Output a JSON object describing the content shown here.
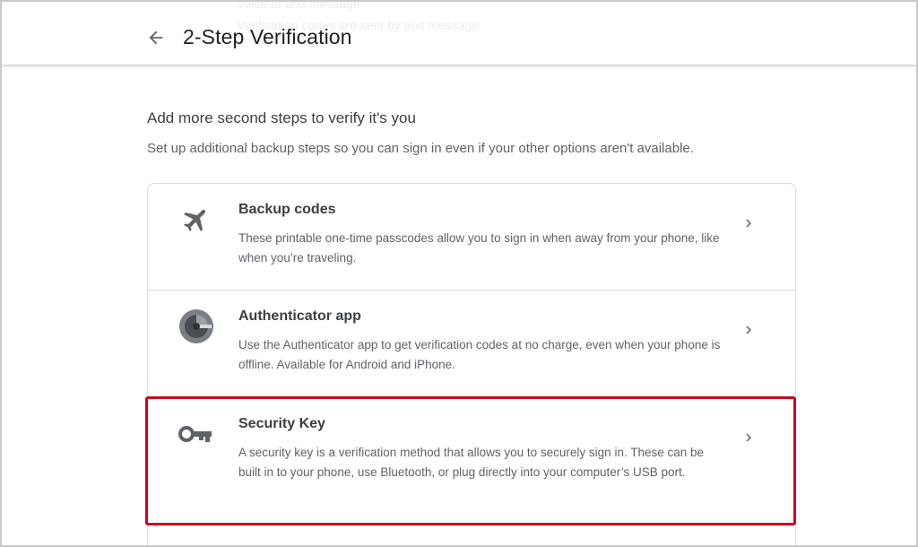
{
  "header": {
    "title": "2-Step Verification",
    "back_label": "Back",
    "ghost_line_1": "Voice or text message",
    "ghost_line_2": "Verification codes are sent by text message"
  },
  "section": {
    "heading": "Add more second steps to verify it's you",
    "description": "Set up additional backup steps so you can sign in even if your other options aren't available."
  },
  "options": [
    {
      "title": "Backup codes",
      "description": "These printable one-time passcodes allow you to sign in when away from your phone, like when you’re traveling.",
      "icon": "airplane-icon"
    },
    {
      "title": "Authenticator app",
      "description": "Use the Authenticator app to get verification codes at no charge, even when your phone is offline. Available for Android and iPhone.",
      "icon": "authenticator-icon"
    },
    {
      "title": "Security Key",
      "description": "A security key is a verification method that allows you to securely sign in. These can be built in to your phone, use Bluetooth, or plug directly into your computer’s USB port.",
      "icon": "key-icon",
      "highlighted": true
    }
  ],
  "colors": {
    "highlight": "#d0021b",
    "icon": "#5f6368",
    "title": "#202124",
    "divider": "#dadce0"
  }
}
